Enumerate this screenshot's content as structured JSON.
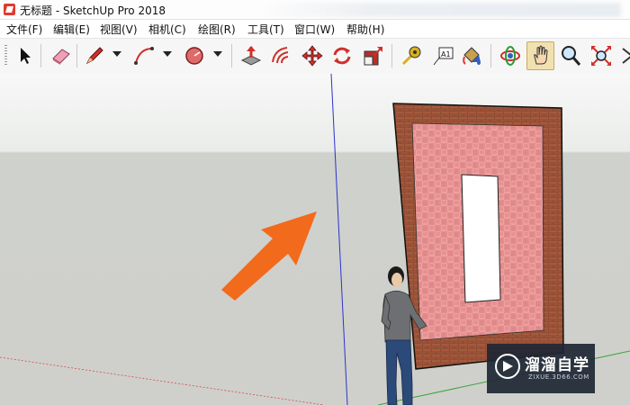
{
  "window": {
    "title": "无标题 - SketchUp Pro 2018"
  },
  "menu": [
    {
      "label": "文件(F)"
    },
    {
      "label": "编辑(E)"
    },
    {
      "label": "视图(V)"
    },
    {
      "label": "相机(C)"
    },
    {
      "label": "绘图(R)"
    },
    {
      "label": "工具(T)"
    },
    {
      "label": "窗口(W)"
    },
    {
      "label": "帮助(H)"
    }
  ],
  "toolbar": {
    "tools": [
      {
        "icon": "select-arrow-icon"
      },
      {
        "icon": "eraser-icon"
      },
      {
        "icon": "pencil-line-icon"
      },
      {
        "icon": "arc-icon"
      },
      {
        "icon": "shape-icon"
      },
      {
        "icon": "push-pull-icon"
      },
      {
        "icon": "offset-icon"
      },
      {
        "icon": "move-icon"
      },
      {
        "icon": "rotate-icon"
      },
      {
        "icon": "scale-icon"
      },
      {
        "icon": "tape-measure-icon"
      },
      {
        "icon": "text-icon",
        "label": "A1"
      },
      {
        "icon": "paint-bucket-icon"
      },
      {
        "icon": "orbit-icon"
      },
      {
        "icon": "pan-hand-icon"
      },
      {
        "icon": "zoom-icon"
      },
      {
        "icon": "zoom-extents-icon"
      },
      {
        "icon": "more-icon"
      }
    ],
    "active_tool": "pan-hand-icon"
  },
  "watermark": {
    "name": "溜溜自学",
    "url": "ZIXUE.3D66.COM"
  },
  "colors": {
    "arrow": "#f26a1b",
    "brick": "#8b4a32",
    "pink_tile": "#e48d8d",
    "sky": "#eef0ee",
    "ground": "#cfd0cc",
    "watermark_bg": "#1e2634"
  }
}
